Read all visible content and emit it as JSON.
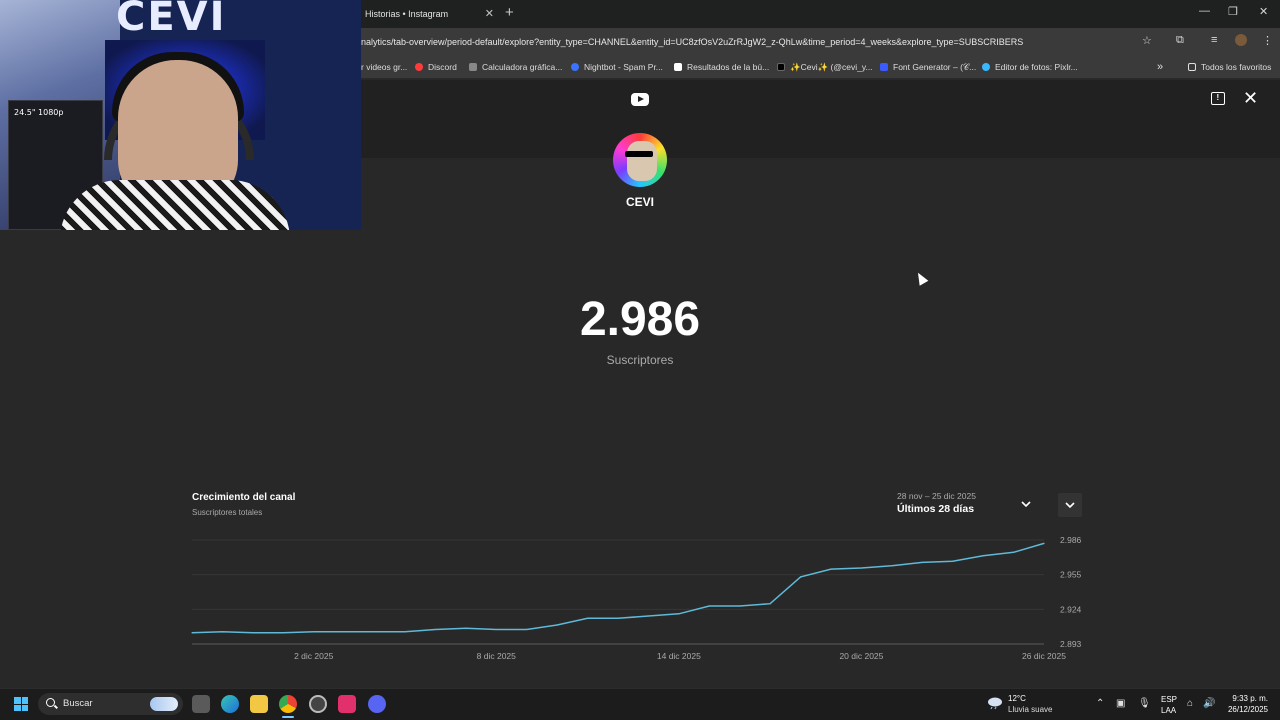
{
  "browser": {
    "tab_title": "Historias • Instagram",
    "tab_close": "✕",
    "new_tab": "+",
    "url": "nalytics/tab-overview/period-default/explore?entity_type=CHANNEL&entity_id=UC8zfOsV2uZrRJgW2_z-QhLw&time_period=4_weeks&explore_type=SUBSCRIBERS",
    "window_controls": {
      "minimize": "—",
      "restore": "❐",
      "close": "✕"
    },
    "bookmarks": [
      {
        "label": "r videos gr...",
        "color": ""
      },
      {
        "label": "Discord",
        "color": "#ff3b3b"
      },
      {
        "label": "Calculadora gráfica...",
        "color": "#888888"
      },
      {
        "label": "Nightbot - Spam Pr...",
        "color": "#3a73ff"
      },
      {
        "label": "Resultados de la bú...",
        "color": "#ffffff"
      },
      {
        "label": "✨Cevi✨ (@cevi_y...",
        "color": "#000000"
      },
      {
        "label": "Font Generator – (𝒞...",
        "color": "#3a5bff"
      },
      {
        "label": "Editor de fotos: Pixlr...",
        "color": "#3ab8ff"
      }
    ],
    "bookmarks_more": "»",
    "all_favorites": "Todos los favoritos"
  },
  "webcam": {
    "logo_text": "CEVI",
    "pc_label": "24.5\" 1080p"
  },
  "channel": {
    "name": "CEVI",
    "subscriber_count": "2.986",
    "subscriber_label": "Suscriptores"
  },
  "chart_card": {
    "title": "Crecimiento del canal",
    "subtitle": "Suscriptores totales",
    "period_range": "28 nov – 25 dic 2025",
    "period_label": "Últimos 28 días"
  },
  "chart_data": {
    "type": "line",
    "title": "Crecimiento del canal",
    "subtitle": "Suscriptores totales",
    "x": [
      "28 nov",
      "29 nov",
      "30 nov",
      "1 dic",
      "2 dic",
      "3 dic",
      "4 dic",
      "5 dic",
      "6 dic",
      "7 dic",
      "8 dic",
      "9 dic",
      "10 dic",
      "11 dic",
      "12 dic",
      "13 dic",
      "14 dic",
      "15 dic",
      "16 dic",
      "17 dic",
      "18 dic",
      "19 dic",
      "20 dic",
      "21 dic",
      "22 dic",
      "23 dic",
      "24 dic",
      "25 dic",
      "26 dic"
    ],
    "series": [
      {
        "values": [
          2903,
          2904,
          2903,
          2903,
          2904,
          2904,
          2904,
          2904,
          2906,
          2907,
          2906,
          2906,
          2910,
          2916,
          2916,
          2918,
          2920,
          2927,
          2927,
          2929,
          2953,
          2960,
          2961,
          2963,
          2966,
          2967,
          2972,
          2975,
          2983
        ],
        "color": "#5fb9d8"
      }
    ],
    "ylim": [
      2893,
      2986
    ],
    "yticks": [
      "2.986",
      "2.955",
      "2.924",
      "2.893"
    ],
    "xticks": [
      {
        "label": "2 dic 2025",
        "index": 4
      },
      {
        "label": "8 dic 2025",
        "index": 10
      },
      {
        "label": "14 dic 2025",
        "index": 16
      },
      {
        "label": "20 dic 2025",
        "index": 22
      },
      {
        "label": "26 dic 2025",
        "index": 28
      }
    ],
    "grid": true
  },
  "taskbar": {
    "search_label": "Buscar",
    "weather_temp": "12°C",
    "weather_desc": "Lluvia suave",
    "lang_line1": "ESP",
    "lang_line2": "LAA",
    "time": "9:33 p. m.",
    "date": "26/12/2025"
  }
}
